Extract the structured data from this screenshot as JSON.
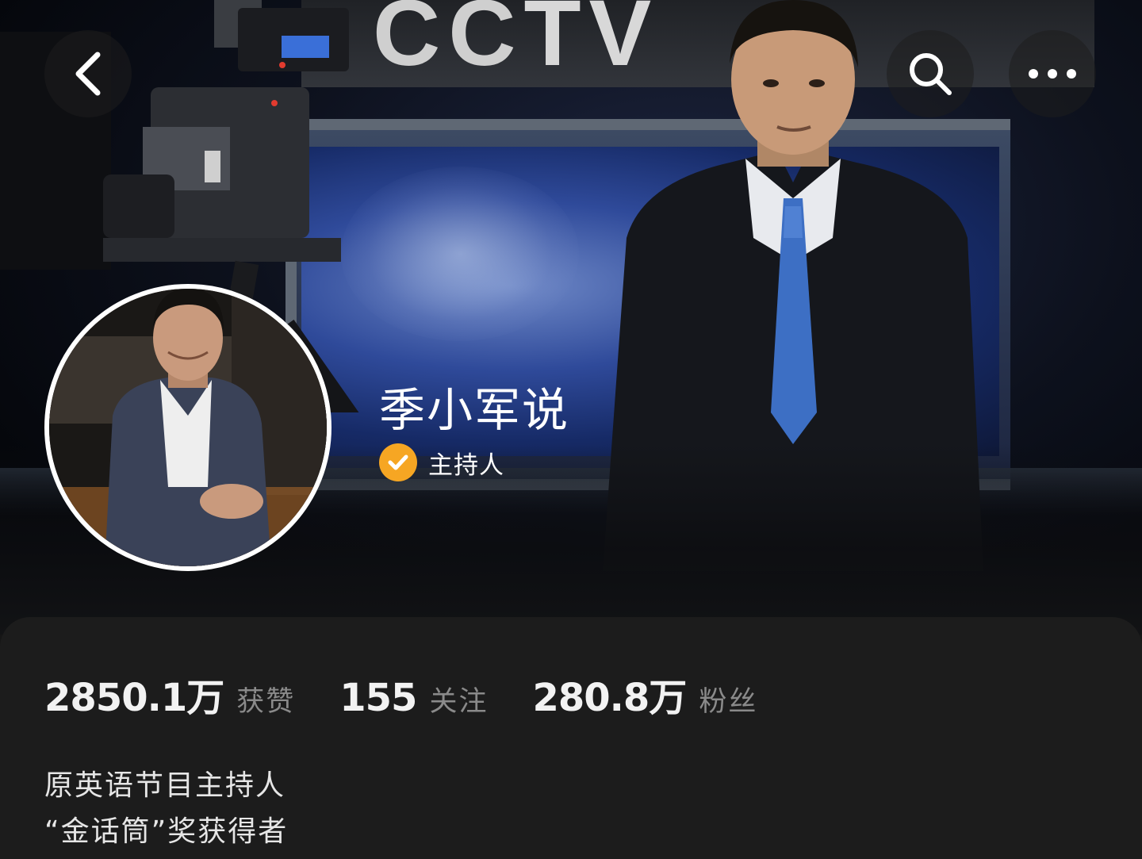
{
  "header": {
    "back_icon": "chevron-left-icon",
    "search_icon": "search-icon",
    "more_icon": "more-horizontal-icon"
  },
  "cover": {
    "logo_text_a": "CC",
    "logo_text_b": "TV",
    "description": "Studio cover photo with news anchor and broadcast camera"
  },
  "profile": {
    "name": "季小军说",
    "verified_icon": "verified-check-icon",
    "verified_color": "#f6a623",
    "verified_label": "主持人"
  },
  "stats": [
    {
      "value": "2850.1万",
      "label": "获赞"
    },
    {
      "value": "155",
      "label": "关注"
    },
    {
      "value": "280.8万",
      "label": "粉丝"
    }
  ],
  "bio": {
    "lines": [
      "原英语节目主持人",
      "“金话筒”奖获得者"
    ]
  }
}
